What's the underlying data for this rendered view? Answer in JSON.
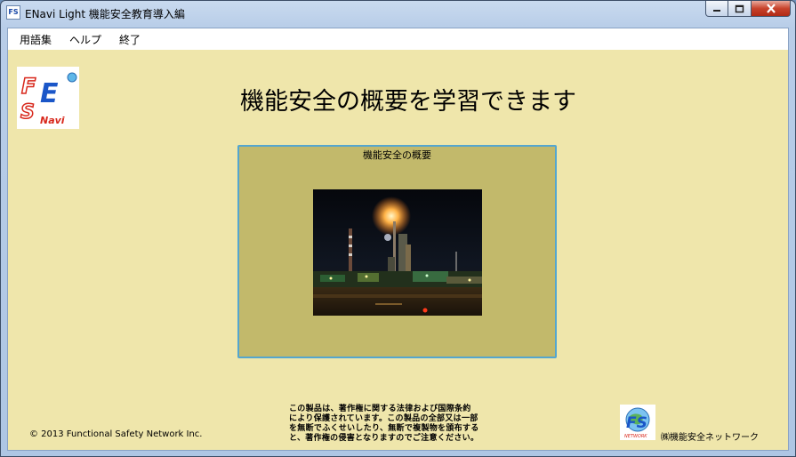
{
  "window": {
    "title": "ENavi Light 機能安全教育導入編",
    "app_icon_text": "FS"
  },
  "menu": {
    "items": [
      "用語集",
      "ヘルプ",
      "終了"
    ]
  },
  "logo": {
    "letters": [
      "F",
      "E",
      "S"
    ],
    "brand_text": "Navi"
  },
  "main": {
    "headline": "機能安全の概要を学習できます",
    "panel_title": "機能安全の概要"
  },
  "footer": {
    "copyright": "© 2013 Functional Safety Network Inc.",
    "notice_lines": [
      "この製品は、著作権に関する法律および国際条約",
      "により保護されています。この製品の全部又は一部",
      "を無断でふくせいしたり、無断で複製物を頒布する",
      "と、著作権の侵害となりますのでご注意ください。"
    ],
    "company_logo_text": "FS",
    "company_logo_sub": "NETWORK",
    "company_name": "㈱機能安全ネットワーク"
  },
  "colors": {
    "client_bg": "#efe6ab",
    "panel_bg": "#c2b96b",
    "panel_border": "#54a6cf",
    "logo_red": "#d8281c",
    "logo_blue": "#1a56c8"
  }
}
